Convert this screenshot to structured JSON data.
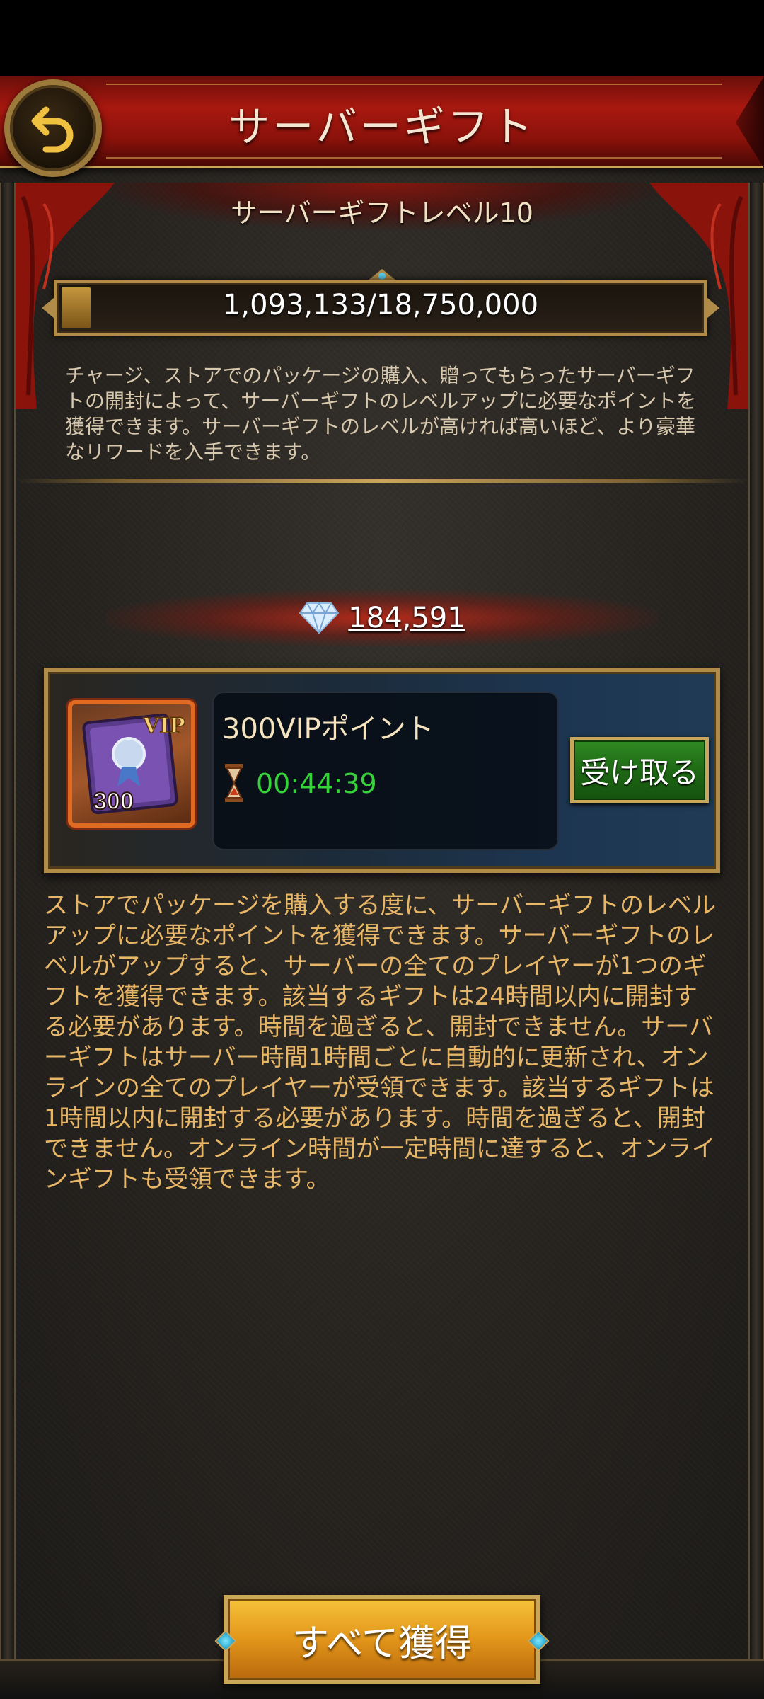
{
  "header": {
    "title": "サーバーギフト"
  },
  "level": {
    "label": "サーバーギフトレベル10"
  },
  "progress": {
    "text": "1,093,133/18,750,000",
    "fraction": 0.058
  },
  "intro_text": "チャージ、ストアでのパッケージの購入、贈ってもらったサーバーギフトの開封によって、サーバーギフトのレベルアップに必要なポイントを獲得できます。サーバーギフトのレベルが高ければ高いほど、より豪華なリワードを入手できます。",
  "diamonds": {
    "value": "184,591",
    "icon": "diamond-icon"
  },
  "gift": {
    "name": "300VIPポイント",
    "timer": "00:44:39",
    "claim_label": "受け取る",
    "icon_vip": "VIP",
    "icon_amount": "300"
  },
  "description": "ストアでパッケージを購入する度に、サーバーギフトのレベルアップに必要なポイントを獲得できます。サーバーギフトのレベルがアップすると、サーバーの全てのプレイヤーが1つのギフトを獲得できます。該当するギフトは24時間以内に開封する必要があります。時間を過ぎると、開封できません。サーバーギフトはサーバー時間1時間ごとに自動的に更新され、オンラインの全てのプレイヤーが受領できます。該当するギフトは1時間以内に開封する必要があります。時間を過ぎると、開封できません。オンライン時間が一定時間に達すると、オンラインギフトも受領できます。",
  "footer": {
    "claim_all_label": "すべて獲得"
  },
  "colors": {
    "header_red": "#a8180f",
    "gold": "#c9a65a",
    "timer_green": "#35d23a",
    "desc_text": "#e8b667",
    "claim_green": "#1d6614",
    "claim_all_orange": "#e2951a"
  }
}
